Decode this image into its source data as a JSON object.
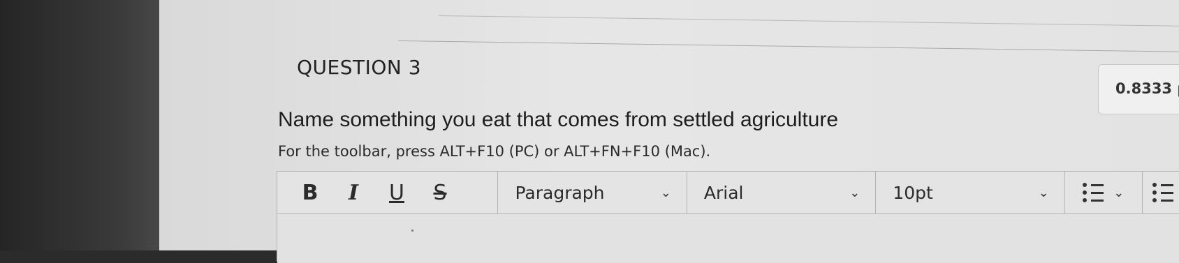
{
  "question": {
    "title": "QUESTION 3",
    "points": "0.8333 p",
    "text": "Name something you eat that comes from settled agriculture",
    "hint": "For the toolbar, press ALT+F10 (PC) or ALT+FN+F10 (Mac)."
  },
  "toolbar": {
    "bold_label": "B",
    "italic_label": "I",
    "underline_label": "U",
    "strike_label": "S",
    "paragraph_select": "Paragraph",
    "font_select": "Arial",
    "size_select": "10pt",
    "chevron": "⌄"
  },
  "icons": [
    "bullet-list-icon",
    "numbered-list-icon",
    "chevron-down-icon"
  ]
}
